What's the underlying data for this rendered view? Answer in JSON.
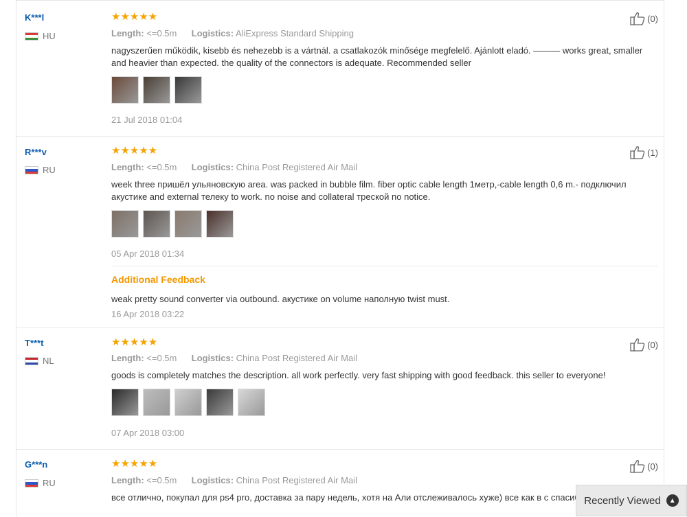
{
  "reviews": [
    {
      "user": "K***l",
      "country": "HU",
      "stars": "★★★★★",
      "length_label": "Length:",
      "length_value": "<=0.5m",
      "logistics_label": "Logistics:",
      "logistics_value": "AliExpress Standard Shipping",
      "text": "nagyszerűen működik, kisebb és nehezebb is a vártnál. a csatlakozók minősége megfelelő. Ajánlott eladó. ——— works great, smaller and heavier than expected. the quality of the connectors is adequate. Recommended seller",
      "date": "21 Jul 2018 01:04",
      "helpful_count": "(0)",
      "thumb_colors": [
        "#6a4a3a",
        "#4a3f36",
        "#3a3a3a"
      ]
    },
    {
      "user": "R***v",
      "country": "RU",
      "stars": "★★★★★",
      "length_label": "Length:",
      "length_value": "<=0.5m",
      "logistics_label": "Logistics:",
      "logistics_value": "China Post Registered Air Mail",
      "text": "week three пришёл ульяновскую area. was packed in bubble film. fiber optic cable length 1метр,-cable length 0,6 m.- подключил акустике and external телеку to work. no noise and collateral треской no notice.",
      "date": "05 Apr 2018 01:34",
      "helpful_count": "(1)",
      "thumb_colors": [
        "#7d7066",
        "#5d5550",
        "#8a7a6e",
        "#4a302a"
      ],
      "additional": {
        "title": "Additional Feedback",
        "text": "weak pretty sound converter via outbound. акустике on volume наполную twist must.",
        "date": "16 Apr 2018 03:22"
      }
    },
    {
      "user": "T***t",
      "country": "NL",
      "stars": "★★★★★",
      "length_label": "Length:",
      "length_value": "<=0.5m",
      "logistics_label": "Logistics:",
      "logistics_value": "China Post Registered Air Mail",
      "text": "goods is completely matches the description. all work perfectly. very fast shipping with good feedback. this seller to everyone!",
      "date": "07 Apr 2018 03:00",
      "helpful_count": "(0)",
      "thumb_colors": [
        "#2a2a2a",
        "#bdbdbd",
        "#cfcfcf",
        "#3a3a3a",
        "#d8d8d8"
      ]
    },
    {
      "user": "G***n",
      "country": "RU",
      "stars": "★★★★★",
      "length_label": "Length:",
      "length_value": "<=0.5m",
      "logistics_label": "Logistics:",
      "logistics_value": "China Post Registered Air Mail",
      "text": "все отлично, покупал для ps4 pro, доставка за пару недель, хотя на Али отслеживалось хуже) все как в с спасибо)",
      "helpful_count": "(0)"
    }
  ],
  "recently_viewed": {
    "label": "Recently Viewed",
    "icon": "chevron-up-icon"
  }
}
